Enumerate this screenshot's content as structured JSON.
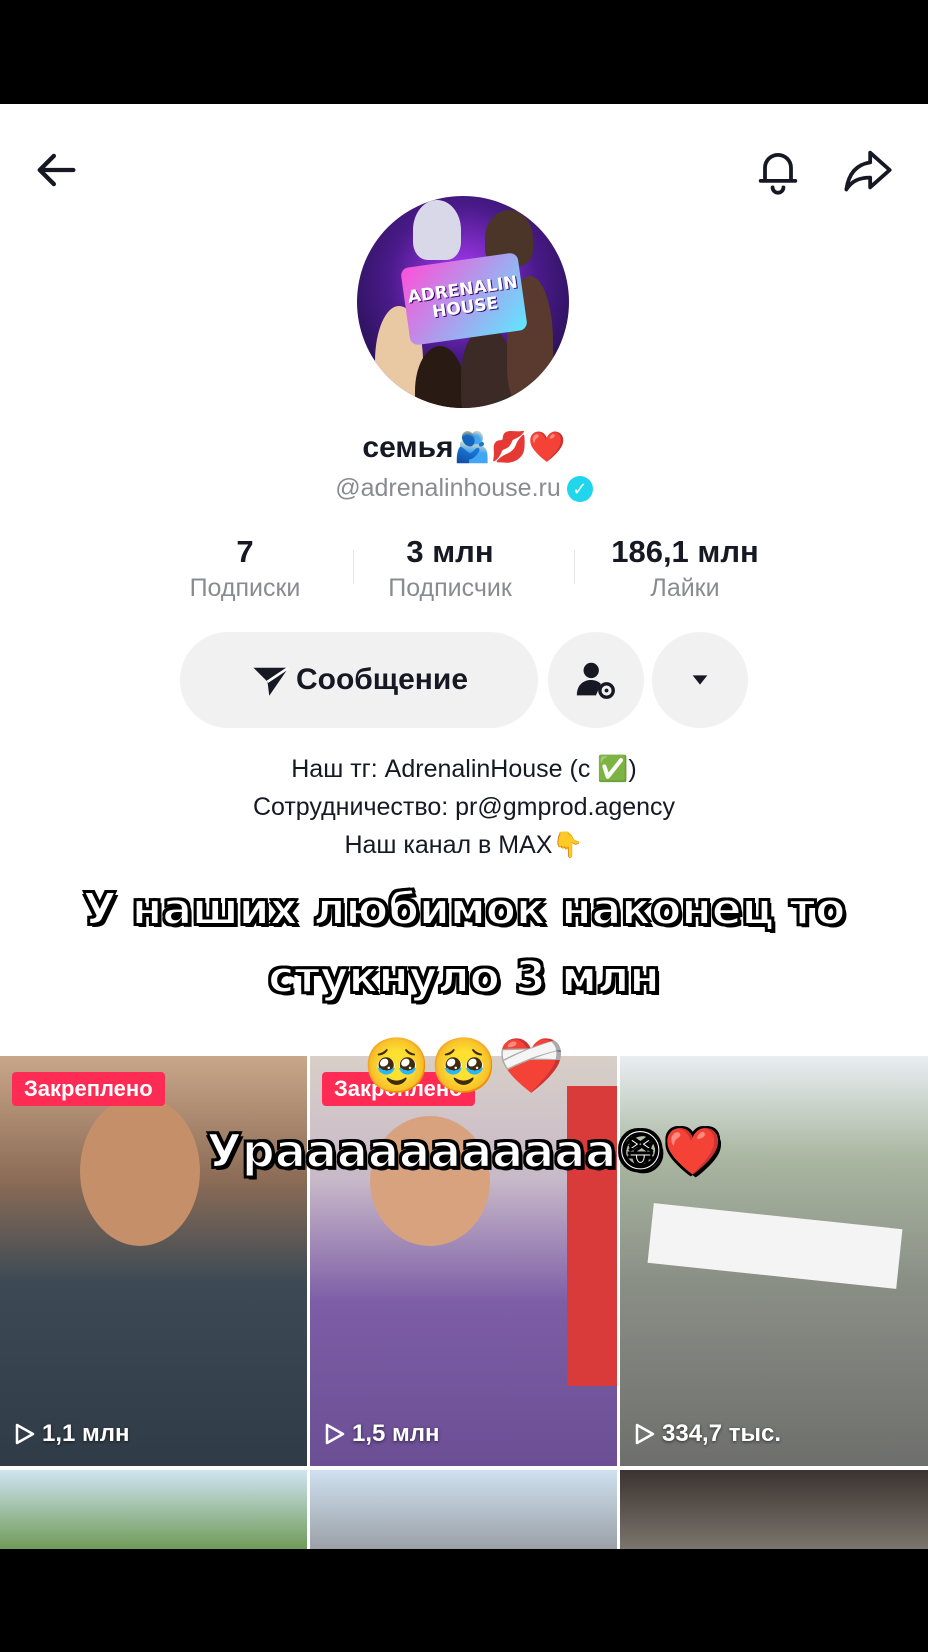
{
  "profile": {
    "display_name": "семья🫂💋❤️",
    "handle": "@adrenalinhouse.ru",
    "avatar_logo_text": "ADRENALIN HOUSE"
  },
  "stats": [
    {
      "value": "7",
      "label": "Подписки"
    },
    {
      "value": "3 млн",
      "label": "Подписчик"
    },
    {
      "value": "186,1 млн",
      "label": "Лайки"
    }
  ],
  "actions": {
    "message_label": "Сообщение"
  },
  "bio": {
    "line1": "Наш тг: AdrenalinHouse (с ✅)",
    "line2": "Сотрудничество: pr@gmprod.agency",
    "line3": "Наш канал в МАХ👇"
  },
  "overlay": {
    "caption_line1": "У наших любимок наконец то",
    "caption_line2": "стукнуло 3 млн",
    "emoji_line": "🥹🥹❤️‍🩹",
    "cheer": "Урааааааааааа😝❤️"
  },
  "videos": [
    {
      "views": "1,1 млн",
      "pinned_label": "Закреплено"
    },
    {
      "views": "1,5 млн",
      "pinned_label": "Закреплено"
    },
    {
      "views": "334,7 тыс."
    }
  ],
  "colors": {
    "accent_red": "#fe2c55",
    "verified": "#20d5ec",
    "button_bg": "#f1f1f2",
    "text_primary": "#161823",
    "text_secondary": "#8a8b91"
  }
}
